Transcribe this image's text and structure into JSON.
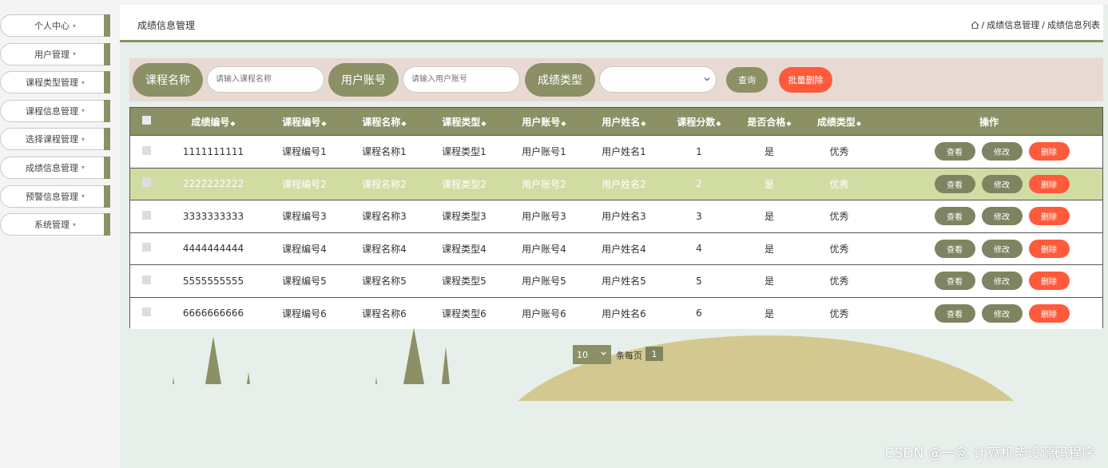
{
  "sidebar": {
    "items": [
      {
        "label": "个人中心"
      },
      {
        "label": "用户管理"
      },
      {
        "label": "课程类型管理"
      },
      {
        "label": "课程信息管理"
      },
      {
        "label": "选择课程管理"
      },
      {
        "label": "成绩信息管理"
      },
      {
        "label": "预警信息管理"
      },
      {
        "label": "系统管理"
      }
    ],
    "caret": "▾"
  },
  "header": {
    "title": "成绩信息管理",
    "breadcrumb": [
      "成绩信息管理",
      "成绩信息列表"
    ],
    "separator": "/"
  },
  "search": {
    "course_name_label": "课程名称",
    "course_name_placeholder": "请输入课程名称",
    "user_account_label": "用户账号",
    "user_account_placeholder": "请输入用户账号",
    "grade_type_label": "成绩类型",
    "grade_type_value": "",
    "query_label": "查询",
    "batch_delete_label": "批量删除"
  },
  "table": {
    "headers": [
      "成绩编号",
      "课程编号",
      "课程名称",
      "课程类型",
      "用户账号",
      "用户姓名",
      "课程分数",
      "是否合格",
      "成绩类型"
    ],
    "ops_header": "操作",
    "sort_glyph": "◆",
    "rows": [
      [
        "1111111111",
        "课程编号1",
        "课程名称1",
        "课程类型1",
        "用户账号1",
        "用户姓名1",
        "1",
        "是",
        "优秀"
      ],
      [
        "2222222222",
        "课程编号2",
        "课程名称2",
        "课程类型2",
        "用户账号2",
        "用户姓名2",
        "2",
        "是",
        "优秀"
      ],
      [
        "3333333333",
        "课程编号3",
        "课程名称3",
        "课程类型3",
        "用户账号3",
        "用户姓名3",
        "3",
        "是",
        "优秀"
      ],
      [
        "4444444444",
        "课程编号4",
        "课程名称4",
        "课程类型4",
        "用户账号4",
        "用户姓名4",
        "4",
        "是",
        "优秀"
      ],
      [
        "5555555555",
        "课程编号5",
        "课程名称5",
        "课程类型5",
        "用户账号5",
        "用户姓名5",
        "5",
        "是",
        "优秀"
      ],
      [
        "6666666666",
        "课程编号6",
        "课程名称6",
        "课程类型6",
        "用户账号6",
        "用户姓名6",
        "6",
        "是",
        "优秀"
      ]
    ],
    "highlighted_row": 1,
    "actions": {
      "view": "查看",
      "edit": "修改",
      "delete": "删除"
    }
  },
  "pagination": {
    "page_size": "10",
    "per_page_label": "条每页",
    "current_page": "1"
  },
  "watermark": "CSDN @一念 计算机毕设源码程序",
  "colors": {
    "accent": "#8b9065",
    "danger": "#ff5a3c",
    "highlight_row": "#d1dca3",
    "hill": "#d4c891",
    "background": "#e6efea"
  }
}
